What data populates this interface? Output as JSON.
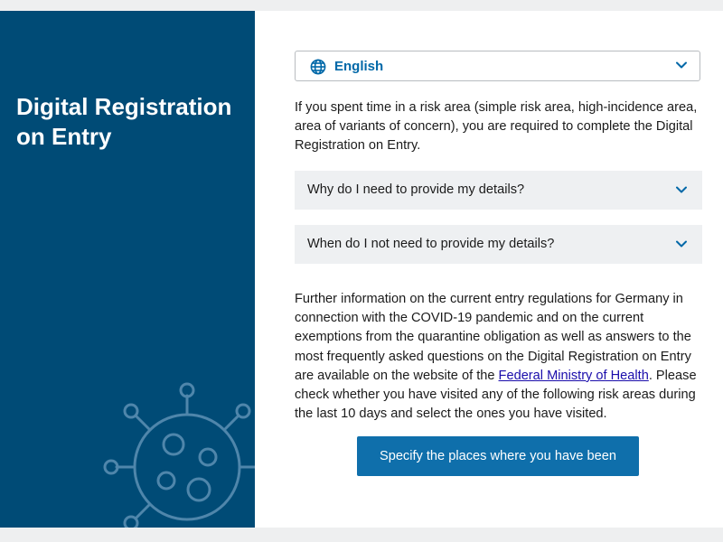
{
  "sidebar": {
    "title": "Digital Registration on Entry"
  },
  "language_select": {
    "selected": "English"
  },
  "intro_text": "If you spent time in a risk area (simple risk area, high-incidence area, area of variants of concern), you are required to complete the Digital Registration on Entry.",
  "accordion": [
    {
      "label": "Why do I need to provide my details?"
    },
    {
      "label": "When do I not need to provide my details?"
    }
  ],
  "info": {
    "text_before": "Further information on the current entry regulations for Germany in connection with the COVID-19 pandemic and on the current exemptions from the quarantine obligation as well as answers to the most frequently asked questions on the Digital Registration on Entry are available on the website of the ",
    "link_text": "Federal Ministry of Health",
    "text_after": ". Please check whether you have visited any of the following risk areas during the last 10 days and select the ones you have visited."
  },
  "cta": {
    "label": "Specify the places where you have been"
  },
  "colors": {
    "sidebar": "#004b76",
    "accent": "#0068a8",
    "button": "#0f6fab",
    "accordion_bg": "#eef0f2"
  },
  "icons": [
    "globe-icon",
    "chevron-down-icon",
    "virus-illustration"
  ]
}
